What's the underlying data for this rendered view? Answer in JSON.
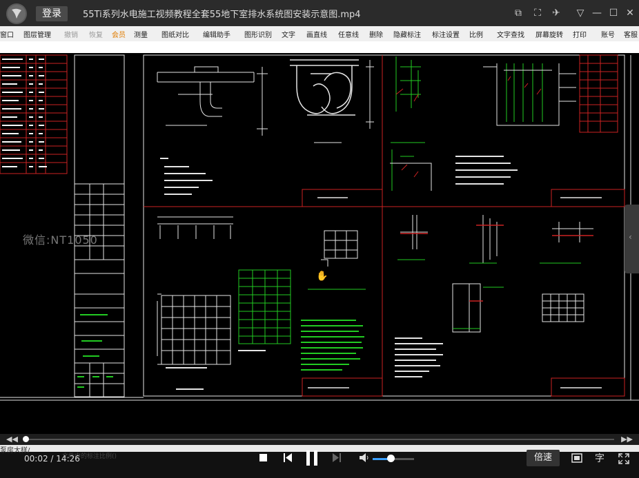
{
  "window": {
    "login_label": "登录",
    "title": "55Ti系列水电施工视频教程全套55地下室排水系统图安装示意图.mp4",
    "buttons": [
      "screenshot-icon",
      "fullscreen-window-icon",
      "pin-icon",
      "collapse-icon",
      "minimize-icon",
      "maximize-icon",
      "close-icon"
    ]
  },
  "menu": {
    "items": [
      {
        "label": "窗口",
        "state": "normal"
      },
      {
        "label": "图层管理",
        "state": "normal"
      },
      {
        "label": "撤销",
        "state": "disabled"
      },
      {
        "label": "恢复",
        "state": "disabled"
      },
      {
        "label": "会员",
        "state": "highlight"
      },
      {
        "label": "测量",
        "state": "normal"
      },
      {
        "label": "图纸对比",
        "state": "normal"
      },
      {
        "label": "编辑助手",
        "state": "normal"
      },
      {
        "label": "图形识别",
        "state": "normal"
      },
      {
        "label": "文字",
        "state": "normal"
      },
      {
        "label": "画直线",
        "state": "normal"
      },
      {
        "label": "任意线",
        "state": "normal"
      },
      {
        "label": "删除",
        "state": "normal"
      },
      {
        "label": "隐藏标注",
        "state": "normal"
      },
      {
        "label": "标注设置",
        "state": "normal"
      },
      {
        "label": "比例",
        "state": "normal"
      },
      {
        "label": "文字查找",
        "state": "normal"
      },
      {
        "label": "屏幕旋转",
        "state": "normal"
      },
      {
        "label": "打印",
        "state": "normal"
      },
      {
        "label": "账号",
        "state": "normal"
      },
      {
        "label": "客服",
        "state": "normal"
      }
    ]
  },
  "video": {
    "watermark": "微信:NT1050"
  },
  "player": {
    "seek_back": "◀◀",
    "seek_forward": "▶▶",
    "progress": 0.0024,
    "strip_text": "泵房大样/",
    "strip_text2": "文件中的标注比例()",
    "current_time": "00:02",
    "separator": "/",
    "total_time": "14:26",
    "volume": 0.45,
    "speed_label": "倍速",
    "subtitle_label": "字"
  },
  "colors": {
    "titlebar": "#2b2b2b",
    "menubar": "#f0f0f0",
    "cad_red": "#cc2222",
    "cad_green": "#22cc22",
    "cad_white": "#e6e6e6",
    "accent_blue": "#3aa0ff"
  }
}
